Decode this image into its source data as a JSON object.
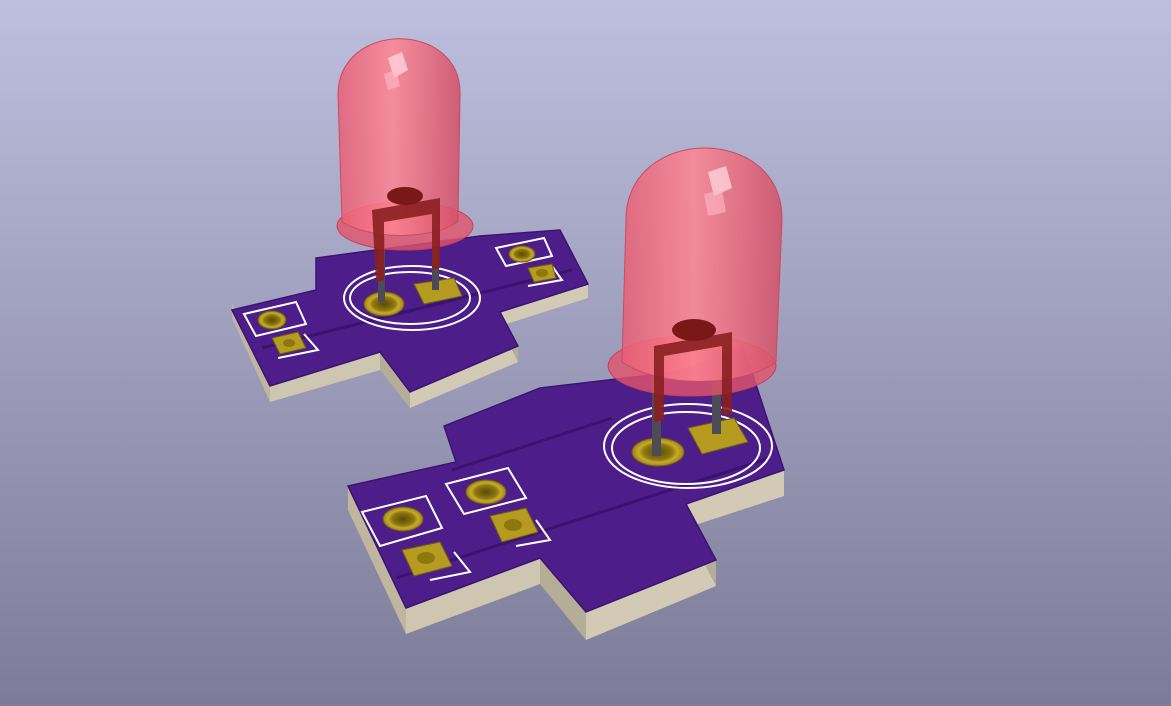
{
  "scene": {
    "kind": "3d-pcb-render",
    "background": {
      "top": "#bebede",
      "bottom": "#7c7c98"
    },
    "colors": {
      "soldermask": "#4d1e8a",
      "soldermask_edge": "#3a1470",
      "board_side": "#cfc6b1",
      "board_side_dark": "#b8ae97",
      "pad": "#b59b1f",
      "pad_dark": "#6e5d10",
      "pad_hole": "#8d7810",
      "silkscreen": "#ffffff",
      "led_body": "#ff6f7f",
      "led_body_dark": "#d9506a",
      "led_frame": "#8a1f1f",
      "pin": "#555560"
    },
    "boards": [
      {
        "name": "board-upper-left",
        "pads": [
          {
            "shape": "round"
          },
          {
            "shape": "square"
          },
          {
            "shape": "round"
          },
          {
            "shape": "square"
          },
          {
            "shape": "round"
          },
          {
            "shape": "square"
          }
        ],
        "led": {
          "has_dome": true,
          "has_leads": 2
        }
      },
      {
        "name": "board-lower-right",
        "pads": [
          {
            "shape": "round"
          },
          {
            "shape": "round"
          },
          {
            "shape": "square"
          },
          {
            "shape": "square"
          },
          {
            "shape": "round"
          },
          {
            "shape": "square"
          }
        ],
        "led": {
          "has_dome": true,
          "has_leads": 2
        }
      }
    ]
  }
}
